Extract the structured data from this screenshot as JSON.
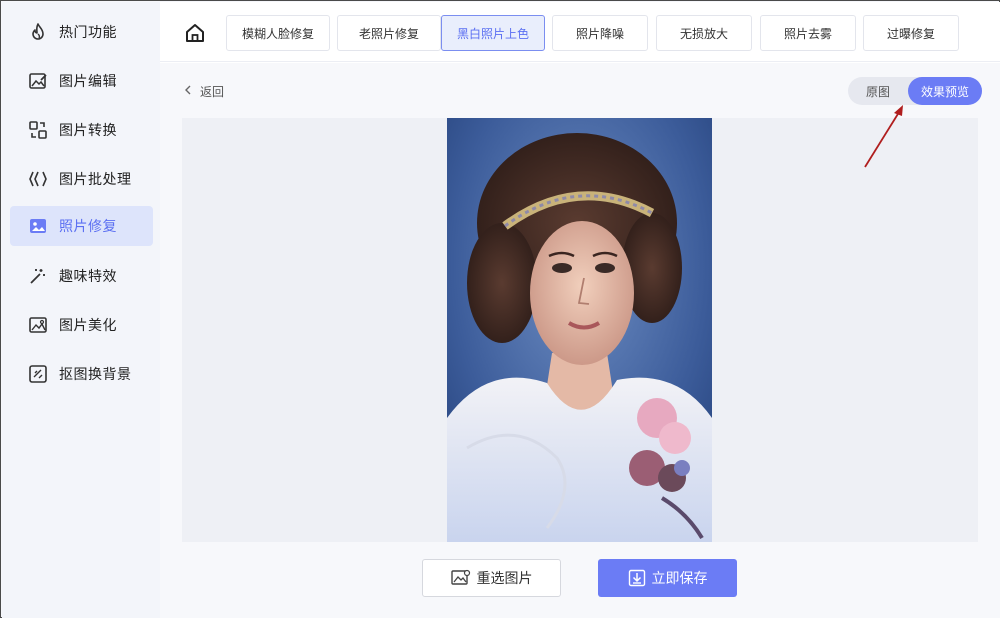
{
  "sidebar": {
    "items": [
      {
        "label": "热门功能",
        "icon": "flame-icon"
      },
      {
        "label": "图片编辑",
        "icon": "image-edit-icon"
      },
      {
        "label": "图片转换",
        "icon": "convert-icon"
      },
      {
        "label": "图片批处理",
        "icon": "batch-icon"
      },
      {
        "label": "照片修复",
        "icon": "photo-repair-icon",
        "active": true
      },
      {
        "label": "趣味特效",
        "icon": "magic-wand-icon"
      },
      {
        "label": "图片美化",
        "icon": "beautify-icon"
      },
      {
        "label": "抠图换背景",
        "icon": "cutout-icon"
      }
    ]
  },
  "tabs": [
    {
      "label": "模糊人脸修复"
    },
    {
      "label": "老照片修复"
    },
    {
      "label": "黑白照片上色",
      "active": true
    },
    {
      "label": "照片降噪"
    },
    {
      "label": "无损放大"
    },
    {
      "label": "照片去雾"
    },
    {
      "label": "过曝修复"
    }
  ],
  "content": {
    "back_label": "返回",
    "toggle": {
      "original": "原图",
      "preview": "效果预览",
      "selected": "preview"
    },
    "reselect_label": "重选图片",
    "save_label": "立即保存"
  },
  "colors": {
    "accent": "#6b7cf5",
    "active_bg": "#dde4fb",
    "annotation_arrow": "#b01e1e"
  }
}
